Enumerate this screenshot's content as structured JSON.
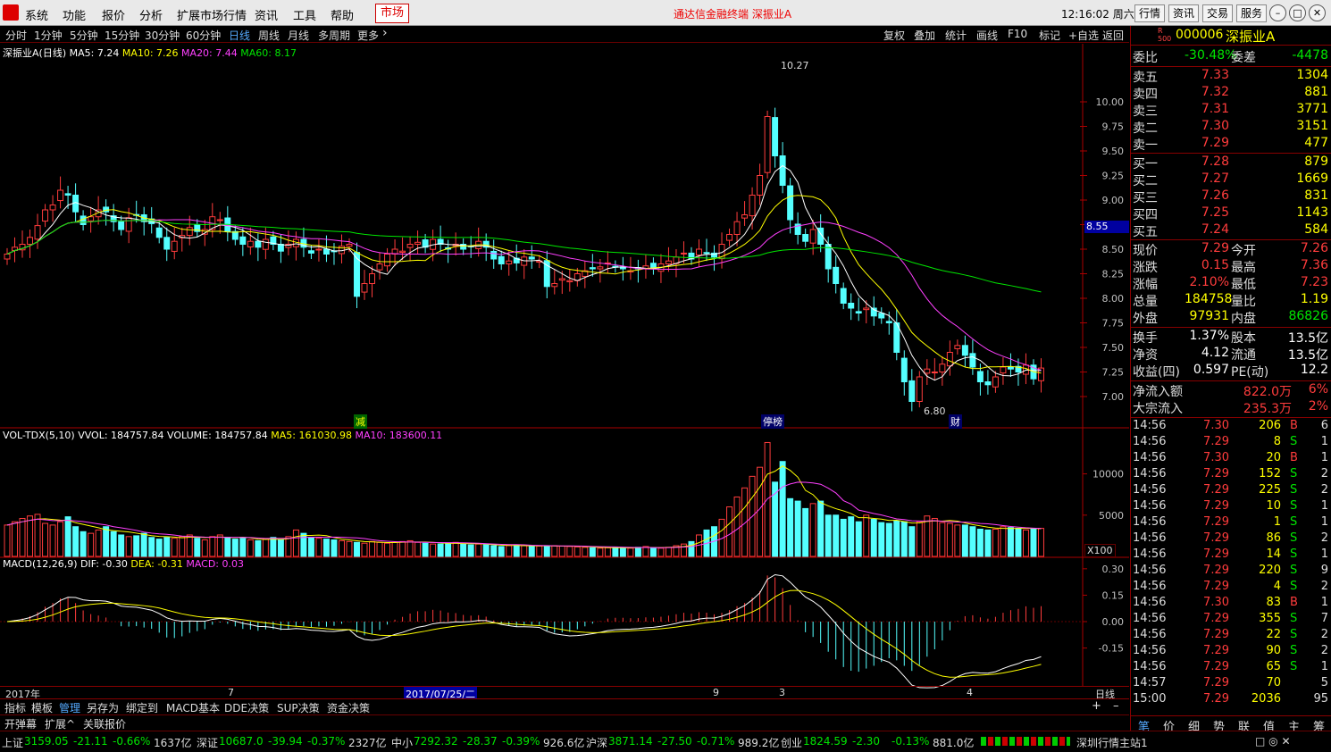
{
  "menu": {
    "items": [
      "系统",
      "功能",
      "报价",
      "分析",
      "扩展市场行情",
      "资讯",
      "工具",
      "帮助"
    ],
    "market_tab": "市场",
    "title": "通达信金融终端 深振业A",
    "clock": "12:16:02 周六",
    "buttons": [
      "行情",
      "资讯",
      "交易",
      "服务"
    ]
  },
  "period": {
    "items": [
      "分时",
      "1分钟",
      "5分钟",
      "15分钟",
      "30分钟",
      "60分钟",
      "日线",
      "周线",
      "月线",
      "多周期",
      "更多"
    ],
    "active": "日线",
    "right_items": [
      "复权",
      "叠加",
      "统计",
      "画线",
      "F10",
      "标记",
      "+自选",
      "返回"
    ]
  },
  "main": {
    "legend": {
      "name": "深振业A(日线)",
      "ma5": "MA5: 7.24",
      "ma10": "MA10: 7.26",
      "ma20": "MA20: 7.44",
      "ma60": "MA60: 8.17"
    },
    "hi_label": "10.27",
    "lo_label": "6.80",
    "marker_price": "8.55",
    "tags": [
      "减",
      "停榜",
      "财"
    ],
    "colors": {
      "up": "#ff3c3c",
      "down": "#54ffff",
      "ma5": "#ffffff",
      "ma10": "#ffff00",
      "ma20": "#ff40ff",
      "ma60": "#00e600"
    }
  },
  "vol": {
    "legend": {
      "name": "VOL-TDX(5,10)",
      "vvol": "VVOL: 184757.84",
      "volume": "VOLUME: 184757.84",
      "ma5": "MA5: 161030.98",
      "ma10": "MA10: 183600.11"
    },
    "unit": "X100"
  },
  "macd": {
    "legend": {
      "name": "MACD(12,26,9)",
      "dif": "DIF: -0.30",
      "dea": "DEA: -0.31",
      "macd": "MACD: 0.03"
    }
  },
  "xaxis": {
    "year": "2017年",
    "ticks": [
      "7",
      "9",
      "3",
      "4"
    ],
    "cursor_date": "2017/07/25/二",
    "period": "日线"
  },
  "bottom": {
    "tabs": [
      "指标",
      "模板",
      "管理",
      "另存为",
      "绑定到",
      "MACD基本",
      "DDE决策",
      "SUP决策",
      "资金决策"
    ],
    "row2": [
      "开弹幕",
      "扩展^",
      "关联报价"
    ]
  },
  "quote": {
    "code": "000006",
    "name": "深振业A",
    "weibi_label": "委比",
    "weibi": "-30.48%",
    "weicha_label": "委差",
    "weicha": "-4478",
    "asks": [
      {
        "label": "卖五",
        "price": "7.33",
        "vol": "1304"
      },
      {
        "label": "卖四",
        "price": "7.32",
        "vol": "881"
      },
      {
        "label": "卖三",
        "price": "7.31",
        "vol": "3771"
      },
      {
        "label": "卖二",
        "price": "7.30",
        "vol": "3151"
      },
      {
        "label": "卖一",
        "price": "7.29",
        "vol": "477"
      }
    ],
    "bids": [
      {
        "label": "买一",
        "price": "7.28",
        "vol": "879"
      },
      {
        "label": "买二",
        "price": "7.27",
        "vol": "1669"
      },
      {
        "label": "买三",
        "price": "7.26",
        "vol": "831"
      },
      {
        "label": "买四",
        "price": "7.25",
        "vol": "1143"
      },
      {
        "label": "买五",
        "price": "7.24",
        "vol": "584"
      }
    ],
    "stats": [
      {
        "l": "现价",
        "v": "7.29",
        "l2": "今开",
        "v2": "7.26"
      },
      {
        "l": "涨跌",
        "v": "0.15",
        "l2": "最高",
        "v2": "7.36"
      },
      {
        "l": "涨幅",
        "v": "2.10%",
        "l2": "最低",
        "v2": "7.23"
      },
      {
        "l": "总量",
        "v": "184758",
        "l2": "量比",
        "v2": "1.19"
      },
      {
        "l": "外盘",
        "v": "97931",
        "l2": "内盘",
        "v2": "86826"
      }
    ],
    "stats2": [
      {
        "l": "换手",
        "v": "1.37%",
        "l2": "股本",
        "v2": "13.5亿"
      },
      {
        "l": "净资",
        "v": "4.12",
        "l2": "流通",
        "v2": "13.5亿"
      },
      {
        "l": "收益(四)",
        "v": "0.597",
        "l2": "PE(动)",
        "v2": "12.2"
      }
    ],
    "flows": [
      {
        "l": "净流入额",
        "v": "822.0万",
        "p": "6%"
      },
      {
        "l": "大宗流入",
        "v": "235.3万",
        "p": "2%"
      }
    ],
    "ticks": [
      {
        "t": "14:56",
        "p": "7.30",
        "q": "206",
        "bs": "B",
        "c": "6"
      },
      {
        "t": "14:56",
        "p": "7.29",
        "q": "8",
        "bs": "S",
        "c": "1"
      },
      {
        "t": "14:56",
        "p": "7.30",
        "q": "20",
        "bs": "B",
        "c": "1"
      },
      {
        "t": "14:56",
        "p": "7.29",
        "q": "152",
        "bs": "S",
        "c": "2"
      },
      {
        "t": "14:56",
        "p": "7.29",
        "q": "225",
        "bs": "S",
        "c": "2"
      },
      {
        "t": "14:56",
        "p": "7.29",
        "q": "10",
        "bs": "S",
        "c": "1"
      },
      {
        "t": "14:56",
        "p": "7.29",
        "q": "1",
        "bs": "S",
        "c": "1"
      },
      {
        "t": "14:56",
        "p": "7.29",
        "q": "86",
        "bs": "S",
        "c": "2"
      },
      {
        "t": "14:56",
        "p": "7.29",
        "q": "14",
        "bs": "S",
        "c": "1"
      },
      {
        "t": "14:56",
        "p": "7.29",
        "q": "220",
        "bs": "S",
        "c": "9"
      },
      {
        "t": "14:56",
        "p": "7.29",
        "q": "4",
        "bs": "S",
        "c": "2"
      },
      {
        "t": "14:56",
        "p": "7.30",
        "q": "83",
        "bs": "B",
        "c": "1"
      },
      {
        "t": "14:56",
        "p": "7.29",
        "q": "355",
        "bs": "S",
        "c": "7"
      },
      {
        "t": "14:56",
        "p": "7.29",
        "q": "22",
        "bs": "S",
        "c": "2"
      },
      {
        "t": "14:56",
        "p": "7.29",
        "q": "90",
        "bs": "S",
        "c": "2"
      },
      {
        "t": "14:56",
        "p": "7.29",
        "q": "65",
        "bs": "S",
        "c": "1"
      },
      {
        "t": "14:57",
        "p": "7.29",
        "q": "70",
        "bs": "",
        "c": "5"
      },
      {
        "t": "15:00",
        "p": "7.29",
        "q": "2036",
        "bs": "",
        "c": "95"
      }
    ],
    "tabs": [
      "笔",
      "价",
      "细",
      "势",
      "联",
      "值",
      "主",
      "筹"
    ]
  },
  "status": {
    "items": [
      {
        "n": "上证",
        "v": "3159.05",
        "d": "-21.11",
        "p": "-0.66%",
        "a": "1637亿"
      },
      {
        "n": "深证",
        "v": "10687.0",
        "d": "-39.94",
        "p": "-0.37%",
        "a": "2327亿"
      },
      {
        "n": "中小",
        "v": "7292.32",
        "d": "-28.37",
        "p": "-0.39%",
        "a": "926.6亿"
      },
      {
        "n": "沪深",
        "v": "3871.14",
        "d": "-27.50",
        "p": "-0.71%",
        "a": "989.2亿"
      },
      {
        "n": "创业",
        "v": "1824.59",
        "d": "-2.30",
        "p": "-0.13%",
        "a": "881.0亿"
      }
    ],
    "site": "深圳行情主站1"
  },
  "chart_data": {
    "type": "candlestick",
    "y_ticks": [
      "10.00",
      "9.75",
      "9.50",
      "9.25",
      "9.00",
      "8.75",
      "8.50",
      "8.25",
      "8.00",
      "7.75",
      "7.50",
      "7.25",
      "7.00"
    ],
    "ylim": [
      6.7,
      10.5
    ],
    "vol_ticks": [
      "10000",
      "5000"
    ],
    "macd_ticks": [
      "0.30",
      "0.15",
      "0.00",
      "-0.15"
    ],
    "closes": [
      8.45,
      8.52,
      8.55,
      8.62,
      8.74,
      8.9,
      8.95,
      9.1,
      9.05,
      8.88,
      8.75,
      8.83,
      8.9,
      8.88,
      8.78,
      8.7,
      8.82,
      8.85,
      8.78,
      8.76,
      8.62,
      8.5,
      8.58,
      8.64,
      8.72,
      8.68,
      8.7,
      8.83,
      8.8,
      8.68,
      8.6,
      8.55,
      8.58,
      8.52,
      8.6,
      8.55,
      8.48,
      8.55,
      8.6,
      8.52,
      8.46,
      8.5,
      8.45,
      8.48,
      8.53,
      8.55,
      8.02,
      8.15,
      8.25,
      8.35,
      8.45,
      8.5,
      8.48,
      8.55,
      8.57,
      8.52,
      8.6,
      8.55,
      8.5,
      8.55,
      8.5,
      8.53,
      8.58,
      8.52,
      8.4,
      8.35,
      8.38,
      8.36,
      8.42,
      8.4,
      8.38,
      8.12,
      8.15,
      8.2,
      8.18,
      8.25,
      8.28,
      8.3,
      8.32,
      8.36,
      8.32,
      8.3,
      8.28,
      8.3,
      8.33,
      8.3,
      8.35,
      8.38,
      8.42,
      8.46,
      8.4,
      8.5,
      8.46,
      8.42,
      8.55,
      8.65,
      8.78,
      8.85,
      9.05,
      9.25,
      9.85,
      9.45,
      9.15,
      8.8,
      8.65,
      8.58,
      8.7,
      8.55,
      8.3,
      8.15,
      7.95,
      7.9,
      7.85,
      7.9,
      7.82,
      7.8,
      7.75,
      7.45,
      7.15,
      6.95,
      7.2,
      7.28,
      7.25,
      7.33,
      7.45,
      7.52,
      7.42,
      7.3,
      7.15,
      7.12,
      7.2,
      7.3,
      7.28,
      7.25,
      7.32,
      7.18,
      7.29
    ],
    "volumes": [
      3800,
      4200,
      4600,
      4900,
      5100,
      4000,
      3800,
      4200,
      4800,
      3600,
      3000,
      2800,
      3200,
      3600,
      3000,
      2600,
      2400,
      2500,
      2800,
      2300,
      2100,
      2300,
      2200,
      2400,
      2600,
      2200,
      2000,
      2400,
      2600,
      2300,
      2100,
      2200,
      2000,
      1900,
      2100,
      2300,
      2000,
      2400,
      3200,
      2800,
      2300,
      2200,
      2100,
      2000,
      1900,
      1800,
      1700,
      1600,
      1800,
      1700,
      1600,
      1700,
      1800,
      1900,
      1700,
      1600,
      1500,
      1500,
      1600,
      1700,
      1500,
      1400,
      1500,
      1400,
      1300,
      1200,
      1300,
      1400,
      1300,
      1200,
      1250,
      1250,
      1300,
      1250,
      1200,
      1150,
      1100,
      1050,
      1000,
      1050,
      1100,
      1050,
      1000,
      1100,
      1200,
      1050,
      1000,
      1100,
      1300,
      1500,
      1800,
      2600,
      3200,
      3600,
      4500,
      6000,
      7200,
      8300,
      9700,
      10800,
      13800,
      9000,
      11500,
      7000,
      6700,
      5800,
      6400,
      6700,
      5000,
      5000,
      4500,
      4800,
      4200,
      5000,
      4500,
      4100,
      4000,
      4300,
      4200,
      3600,
      4200,
      4900,
      4600,
      4100,
      4000,
      3800,
      3800,
      3600,
      3300,
      3200,
      3300,
      3600,
      3500,
      3400,
      3200,
      3300,
      3400
    ]
  }
}
